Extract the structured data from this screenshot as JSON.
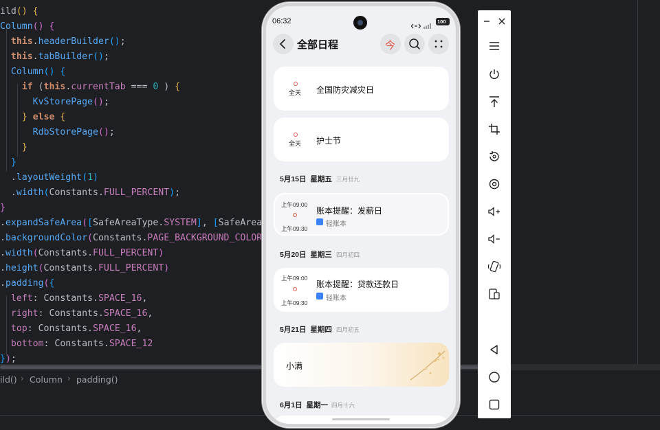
{
  "editor": {
    "lines": [
      {
        "segs": [
          [
            "",
            "ild"
          ],
          [
            "p1",
            "()"
          ],
          [
            "",
            " "
          ],
          [
            "p1",
            "{"
          ]
        ]
      },
      {
        "segs": [
          [
            "fn",
            "Column"
          ],
          [
            "p2",
            "()"
          ],
          [
            "",
            " "
          ],
          [
            "p2",
            "{"
          ]
        ]
      },
      {
        "segs": [
          [
            "",
            "  "
          ],
          [
            "kw",
            "this"
          ],
          [
            "",
            "."
          ],
          [
            "fn",
            "headerBuilder"
          ],
          [
            "p3",
            "()"
          ],
          [
            "",
            ";"
          ]
        ]
      },
      {
        "segs": [
          [
            "",
            "  "
          ],
          [
            "kw",
            "this"
          ],
          [
            "",
            "."
          ],
          [
            "fn",
            "tabBuilder"
          ],
          [
            "p3",
            "()"
          ],
          [
            "",
            ";"
          ]
        ]
      },
      {
        "segs": [
          [
            "",
            "  "
          ],
          [
            "fn",
            "Column"
          ],
          [
            "p3",
            "()"
          ],
          [
            "",
            " "
          ],
          [
            "p3",
            "{"
          ]
        ]
      },
      {
        "segs": [
          [
            "",
            "    "
          ],
          [
            "kw",
            "if"
          ],
          [
            "",
            " ("
          ],
          [
            "kw",
            "this"
          ],
          [
            "",
            "."
          ],
          [
            "pr",
            "currentTab"
          ],
          [
            "",
            " === "
          ],
          [
            "nm",
            "0"
          ],
          [
            "",
            " ) "
          ],
          [
            "p1",
            "{"
          ]
        ]
      },
      {
        "segs": [
          [
            "",
            "      "
          ],
          [
            "fn",
            "KvStorePage"
          ],
          [
            "p2",
            "()"
          ],
          [
            "",
            ";"
          ]
        ]
      },
      {
        "segs": [
          [
            "",
            "    "
          ],
          [
            "p1",
            "}"
          ],
          [
            "",
            " "
          ],
          [
            "kw",
            "else"
          ],
          [
            "",
            " "
          ],
          [
            "p1",
            "{"
          ]
        ]
      },
      {
        "segs": [
          [
            "",
            "      "
          ],
          [
            "fn",
            "RdbStorePage"
          ],
          [
            "p2",
            "()"
          ],
          [
            "",
            ";"
          ]
        ]
      },
      {
        "segs": [
          [
            "",
            "    "
          ],
          [
            "p1",
            "}"
          ]
        ]
      },
      {
        "segs": [
          [
            "",
            "  "
          ],
          [
            "p3",
            "}"
          ]
        ]
      },
      {
        "segs": [
          [
            "",
            "  ."
          ],
          [
            "fn",
            "layoutWeight"
          ],
          [
            "p3",
            "("
          ],
          [
            "nm",
            "1"
          ],
          [
            "p3",
            ")"
          ]
        ]
      },
      {
        "segs": [
          [
            "",
            "  ."
          ],
          [
            "fn",
            "width"
          ],
          [
            "p3",
            "("
          ],
          [
            "",
            "Constants."
          ],
          [
            "pr",
            "FULL_PERCENT"
          ],
          [
            "p3",
            ")"
          ],
          [
            "",
            ";"
          ]
        ]
      },
      {
        "segs": [
          [
            "p2",
            "}"
          ]
        ]
      },
      {
        "segs": [
          [
            "",
            "."
          ],
          [
            "fn",
            "expandSafeArea"
          ],
          [
            "p2",
            "("
          ],
          [
            "p3",
            "["
          ],
          [
            "",
            "SafeAreaType."
          ],
          [
            "pr",
            "SYSTEM"
          ],
          [
            "p3",
            "]"
          ],
          [
            "",
            ", "
          ],
          [
            "p3",
            "["
          ],
          [
            "",
            "SafeArea"
          ]
        ]
      },
      {
        "segs": [
          [
            "",
            "."
          ],
          [
            "fn",
            "backgroundColor"
          ],
          [
            "p2",
            "("
          ],
          [
            "",
            "Constants."
          ],
          [
            "pr",
            "PAGE_BACKGROUND_COLOR"
          ]
        ]
      },
      {
        "segs": [
          [
            "",
            "."
          ],
          [
            "fn",
            "width"
          ],
          [
            "p2",
            "("
          ],
          [
            "",
            "Constants."
          ],
          [
            "pr",
            "FULL_PERCENT"
          ],
          [
            "p2",
            ")"
          ]
        ]
      },
      {
        "segs": [
          [
            "",
            "."
          ],
          [
            "fn",
            "height"
          ],
          [
            "p2",
            "("
          ],
          [
            "",
            "Constants."
          ],
          [
            "pr",
            "FULL_PERCENT"
          ],
          [
            "p2",
            ")"
          ]
        ]
      },
      {
        "segs": [
          [
            "",
            "."
          ],
          [
            "fn",
            "padding"
          ],
          [
            "p2",
            "("
          ],
          [
            "p3",
            "{"
          ]
        ]
      },
      {
        "segs": [
          [
            "",
            "  "
          ],
          [
            "pr",
            "left"
          ],
          [
            "",
            ": Constants."
          ],
          [
            "pr",
            "SPACE_16"
          ],
          [
            "",
            ","
          ]
        ]
      },
      {
        "segs": [
          [
            "",
            "  "
          ],
          [
            "pr",
            "right"
          ],
          [
            "",
            ": Constants."
          ],
          [
            "pr",
            "SPACE_16"
          ],
          [
            "",
            ","
          ]
        ]
      },
      {
        "segs": [
          [
            "",
            "  "
          ],
          [
            "pr",
            "top"
          ],
          [
            "",
            ": Constants."
          ],
          [
            "pr",
            "SPACE_16"
          ],
          [
            "",
            ","
          ]
        ]
      },
      {
        "segs": [
          [
            "",
            "  "
          ],
          [
            "pr",
            "bottom"
          ],
          [
            "",
            ": Constants."
          ],
          [
            "pr",
            "SPACE_12"
          ]
        ]
      },
      {
        "segs": [
          [
            "p3",
            "}"
          ],
          [
            "p2",
            ")"
          ],
          [
            "",
            ";"
          ]
        ]
      }
    ],
    "breadcrumb": [
      "ild()",
      "Column",
      "padding()"
    ]
  },
  "phone": {
    "status_time": "06:32",
    "battery": "100",
    "header": {
      "title": "全部日程",
      "today_label": "今"
    },
    "allday_cards": [
      {
        "allday": "全天",
        "title": "全国防灾减灾日"
      },
      {
        "allday": "全天",
        "title": "护士节"
      }
    ],
    "sections": [
      {
        "date": "5月15日",
        "weekday": "星期五",
        "lunar": "三月廿九",
        "event": {
          "start": "上午09:00",
          "end": "上午09:30",
          "title": "账本提醒：发薪日",
          "app": "轻账本"
        }
      },
      {
        "date": "5月20日",
        "weekday": "星期三",
        "lunar": "四月初四",
        "event": {
          "start": "上午09:00",
          "end": "上午09:30",
          "title": "账本提醒：贷款还款日",
          "app": "轻账本"
        }
      },
      {
        "date": "5月21日",
        "weekday": "星期四",
        "lunar": "四月初五",
        "term": "小满"
      },
      {
        "date": "6月1日",
        "weekday": "星期一",
        "lunar": "四月十六"
      }
    ]
  },
  "colors": {
    "accent": "#e05a4a",
    "app_icon": "#3b82f6"
  },
  "toolbar_icons": [
    "minimize-icon",
    "close-icon",
    "menu-icon",
    "power-icon",
    "pin-top-icon",
    "crop-icon",
    "rotate-icon",
    "screen-record-icon",
    "volume-up-icon",
    "volume-down-icon",
    "shake-icon",
    "multi-screen-icon",
    "nav-back-icon",
    "nav-home-icon",
    "nav-recent-icon"
  ]
}
